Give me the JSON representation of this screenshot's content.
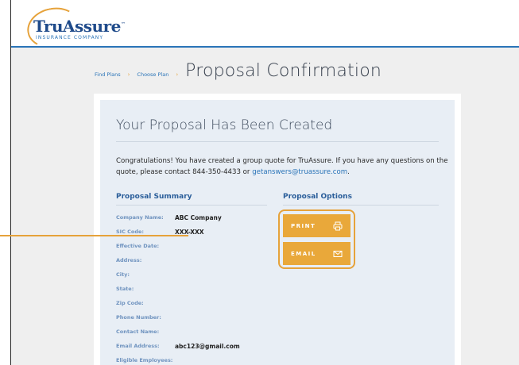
{
  "brand": {
    "name": "TruAssure",
    "tm": "™",
    "subtitle": "INSURANCE COMPANY"
  },
  "breadcrumb": {
    "items": [
      "Find Plans",
      "Choose Plan"
    ],
    "separator": "›"
  },
  "page_title": "Proposal Confirmation",
  "card": {
    "heading": "Your Proposal Has Been Created",
    "intro_text": "Congratulations! You have created a group quote for TruAssure. If you have any questions on the quote, please contact 844-350-4433 or ",
    "intro_email": "getanswers@truassure.com",
    "intro_end": "."
  },
  "summary": {
    "heading": "Proposal Summary",
    "fields": [
      {
        "label": "Company Name:",
        "value": "ABC Company"
      },
      {
        "label": "SIC Code:",
        "value": "XXX-XXX"
      },
      {
        "label": "Effective Date:",
        "value": ""
      },
      {
        "label": "Address:",
        "value": ""
      },
      {
        "label": "City:",
        "value": ""
      },
      {
        "label": "State:",
        "value": ""
      },
      {
        "label": "Zip Code:",
        "value": ""
      },
      {
        "label": "Phone Number:",
        "value": ""
      },
      {
        "label": "Contact Name:",
        "value": ""
      },
      {
        "label": "Email Address:",
        "value": "abc123@gmail.com"
      },
      {
        "label": "Eligible Employees:",
        "value": ""
      }
    ]
  },
  "options": {
    "heading": "Proposal Options",
    "print_label": "PRINT",
    "email_label": "EMAIL",
    "print_icon": "printer-icon",
    "email_icon": "envelope-icon"
  },
  "colors": {
    "accent": "#e9a83a",
    "brand_blue": "#2a74b8",
    "card_bg": "#e8eef5"
  }
}
